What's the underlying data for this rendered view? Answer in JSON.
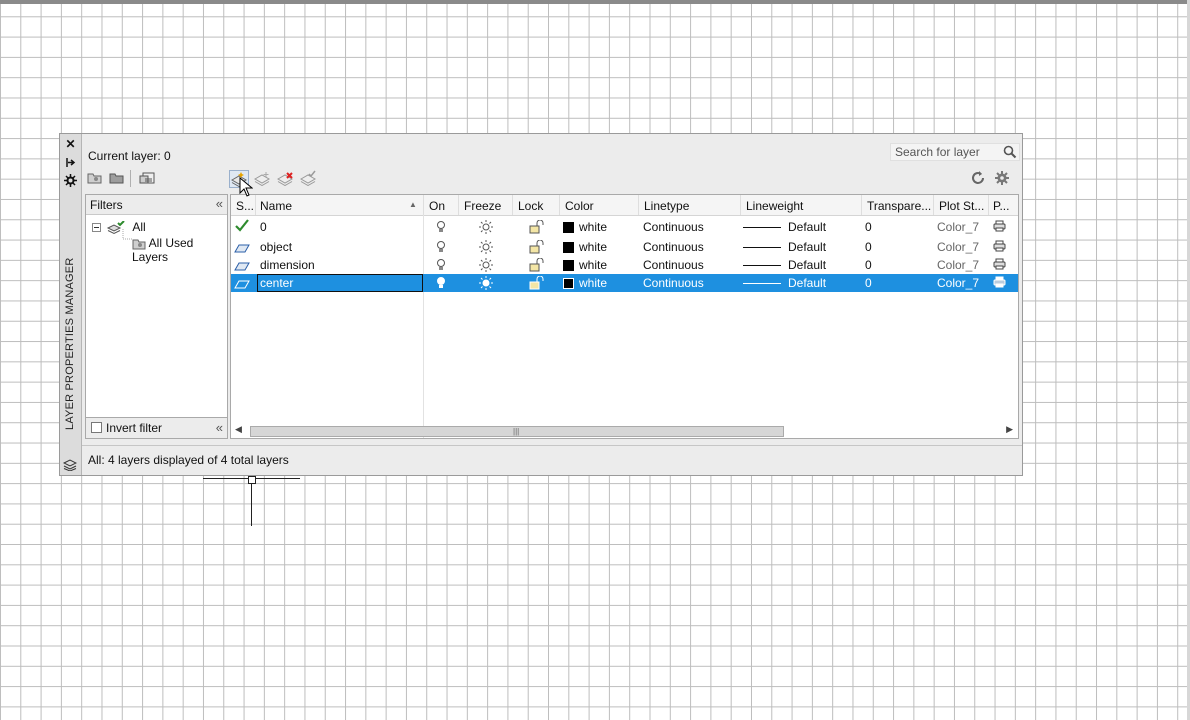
{
  "palette": {
    "title": "LAYER PROPERTIES MANAGER",
    "current_layer_label": "Current layer: 0",
    "search_placeholder": "Search for layer",
    "filters": {
      "header": "Filters",
      "tree": [
        {
          "label": "All"
        },
        {
          "label": "All Used Layers"
        }
      ],
      "invert_filter_label": "Invert filter"
    },
    "columns": [
      "S...",
      "Name",
      "On",
      "Freeze",
      "Lock",
      "Color",
      "Linetype",
      "Lineweight",
      "Transpare...",
      "Plot St...",
      "P..."
    ],
    "layers": [
      {
        "name": "0",
        "color": "white",
        "linetype": "Continuous",
        "lineweight": "Default",
        "transparency": "0",
        "plot_style": "Color_7",
        "current": true
      },
      {
        "name": "object",
        "color": "white",
        "linetype": "Continuous",
        "lineweight": "Default",
        "transparency": "0",
        "plot_style": "Color_7"
      },
      {
        "name": "dimension",
        "color": "white",
        "linetype": "Continuous",
        "lineweight": "Default",
        "transparency": "0",
        "plot_style": "Color_7"
      },
      {
        "name": "center",
        "color": "white",
        "linetype": "Continuous",
        "lineweight": "Default",
        "transparency": "0",
        "plot_style": "Color_7",
        "selected": true
      }
    ],
    "status": "All: 4 layers displayed of 4 total layers"
  },
  "colors": {
    "selection": "#1e90e0",
    "background_grid": "#bdbdbd",
    "current_check": "#2e8b2e"
  },
  "icons": {
    "toolbar": [
      "new-property-filter-icon",
      "new-group-filter-icon",
      "layer-states-manager-icon",
      "new-layer-icon",
      "new-layer-vp-frozen-icon",
      "delete-layer-icon",
      "set-current-icon"
    ],
    "right_toolbar": [
      "refresh-icon",
      "settings-icon"
    ]
  }
}
